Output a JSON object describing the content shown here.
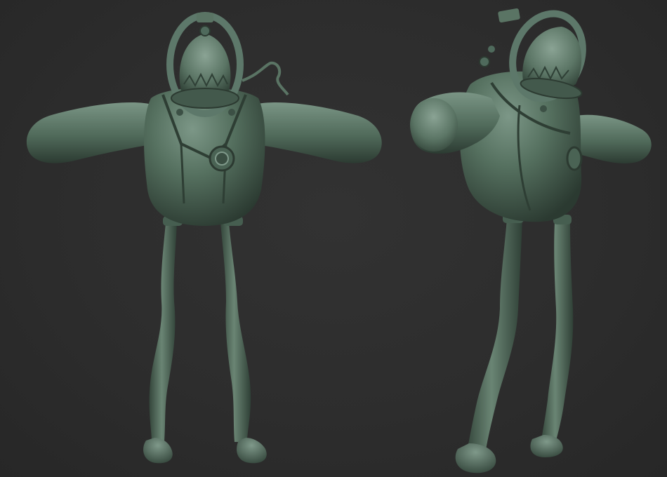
{
  "scene": {
    "background_color": "#2d2d2d",
    "model_color": "#4f6a5c",
    "model_highlight": "#8aa394",
    "model_shadow": "#26342d",
    "views": [
      {
        "id": "front",
        "name": "front-view"
      },
      {
        "id": "three-quarter",
        "name": "three-quarter-view"
      }
    ]
  }
}
